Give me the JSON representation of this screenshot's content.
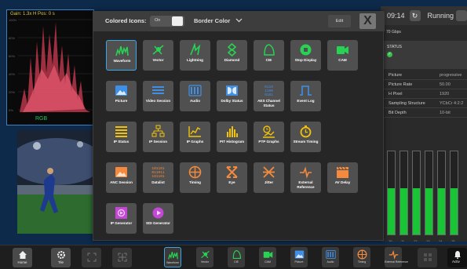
{
  "waveform_tile": {
    "readout": "Gain: 1.3x    H Pos: 0 s",
    "channel": "RGB",
    "scale": [
      "100%",
      "80%",
      "60%",
      "40%",
      "20%",
      "0%"
    ]
  },
  "status_panel": {
    "time": "09:14",
    "running_label": "Running",
    "link_rate": "70 Gbps",
    "status_title": "STATUS",
    "properties": [
      {
        "key": "Picture",
        "value": "progressive"
      },
      {
        "key": "Picture Rate",
        "value": "50.00"
      },
      {
        "key": "H Pixel",
        "value": "1920"
      },
      {
        "key": "Sampling Structure",
        "value": "YCbCr 4:2:2"
      },
      {
        "key": "Bit Depth",
        "value": "10-bit"
      }
    ],
    "meter_channels": [
      "10",
      "11",
      "12",
      "13",
      "14",
      "15"
    ],
    "meter_levels": [
      0.56,
      0.56,
      0.56,
      0.56,
      0.56,
      0.56
    ]
  },
  "dialog": {
    "colored_icons_label": "Colored Icons:",
    "colored_icons_state": "On",
    "border_color_label": "Border Color",
    "edit_label": "Edit",
    "close_glyph": "X",
    "apps": [
      {
        "label": "Waveform",
        "color": "#28d252",
        "icon": "waveform-icon"
      },
      {
        "label": "Vector",
        "color": "#28d252",
        "icon": "vector-icon"
      },
      {
        "label": "Lightning",
        "color": "#28d252",
        "icon": "lightning-icon"
      },
      {
        "label": "Diamond",
        "color": "#28d252",
        "icon": "diamond-icon"
      },
      {
        "label": "CIE",
        "color": "#28d252",
        "icon": "cie-icon"
      },
      {
        "label": "Stop Display",
        "color": "#28d252",
        "icon": "stop-display-icon"
      },
      {
        "label": "CAM",
        "color": "#28d252",
        "icon": "cam-icon"
      },
      {
        "label": "Picture",
        "color": "#3f8fe6",
        "icon": "picture-icon"
      },
      {
        "label": "Video Session",
        "color": "#3f8fe6",
        "icon": "video-session-icon"
      },
      {
        "label": "Audio",
        "color": "#3f8fe6",
        "icon": "audio-icon"
      },
      {
        "label": "Dolby Status",
        "color": "#3f8fe6",
        "icon": "dolby-icon"
      },
      {
        "label": "AES Channel Status",
        "color": "#3f8fe6",
        "icon": "aes-channel-icon"
      },
      {
        "label": "Event Log",
        "color": "#3f8fe6",
        "icon": "event-log-icon"
      },
      {
        "label": "IP Status",
        "color": "#f0c20c",
        "icon": "ip-status-icon"
      },
      {
        "label": "IP Session",
        "color": "#f0c20c",
        "icon": "ip-session-icon"
      },
      {
        "label": "IP Graphs",
        "color": "#f0c20c",
        "icon": "ip-graphs-icon"
      },
      {
        "label": "PIT Histogram",
        "color": "#f0c20c",
        "icon": "pit-histogram-icon"
      },
      {
        "label": "PTP Graphs",
        "color": "#f0c20c",
        "icon": "ptp-graphs-icon"
      },
      {
        "label": "Stream Timing",
        "color": "#f0c20c",
        "icon": "stream-timing-icon"
      },
      {
        "label": "ANC Session",
        "color": "#f58a3c",
        "icon": "anc-session-icon"
      },
      {
        "label": "Datalist",
        "color": "#f58a3c",
        "icon": "datalist-icon"
      },
      {
        "label": "Timing",
        "color": "#f58a3c",
        "icon": "timing-icon"
      },
      {
        "label": "Eye",
        "color": "#f58a3c",
        "icon": "eye-icon"
      },
      {
        "label": "Jitter",
        "color": "#f58a3c",
        "icon": "jitter-icon"
      },
      {
        "label": "External Reference",
        "color": "#f58a3c",
        "icon": "external-reference-icon"
      },
      {
        "label": "AV Delay",
        "color": "#f58a3c",
        "icon": "av-delay-icon"
      },
      {
        "label": "IP Generator",
        "color": "#c447d6",
        "icon": "ip-generator-icon"
      },
      {
        "label": "SDI Generator",
        "color": "#c447d6",
        "icon": "sdi-generator-icon"
      }
    ]
  },
  "toolbar": {
    "home_label": "Home",
    "tile_label": "Tile",
    "apps": [
      {
        "label": "Waveform",
        "color": "#28d252"
      },
      {
        "label": "Vector",
        "color": "#28d252"
      },
      {
        "label": "CIE",
        "color": "#28d252"
      },
      {
        "label": "CAM",
        "color": "#28d252"
      },
      {
        "label": "Picture",
        "color": "#3f8fe6"
      },
      {
        "label": "Audio",
        "color": "#3f8fe6"
      },
      {
        "label": "Timing",
        "color": "#f58a3c"
      },
      {
        "label": "External Reference",
        "color": "#f58a3c"
      }
    ],
    "active_label": "Activ"
  }
}
